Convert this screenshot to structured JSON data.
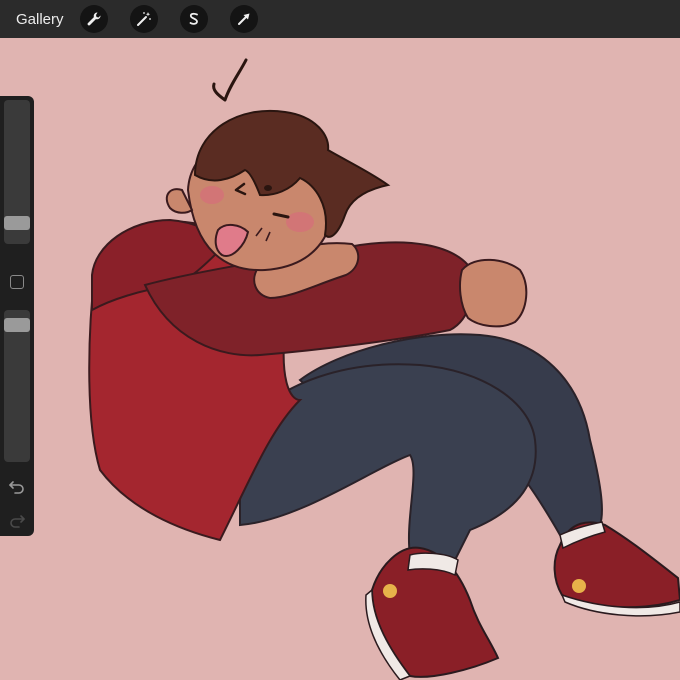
{
  "toolbar": {
    "gallery_label": "Gallery",
    "tools": [
      {
        "icon": "wrench-icon",
        "name": "actions"
      },
      {
        "icon": "magic-wand-icon",
        "name": "adjustments"
      },
      {
        "icon": "selection-s-icon",
        "name": "selection"
      },
      {
        "icon": "arrow-cursor-icon",
        "name": "transform"
      }
    ]
  },
  "sidebar": {
    "brush_size_level": 0.2,
    "opacity_level": 0.93,
    "undo_icon": "undo-icon",
    "redo_icon": "redo-icon"
  },
  "colors": {
    "canvas_background": "#e0b4b1",
    "toolbar_background": "#2b2b2b",
    "sidebar_background": "#1f1f1f",
    "hoodie_red": "#a4262f",
    "hoodie_dark_red": "#7f2229",
    "jeans_blue": "#373c4c",
    "hair_brown": "#5a2c22",
    "skin": "#c9876d",
    "shoe_red": "#8a1f27",
    "shoe_dot_yellow": "#e7b24a"
  }
}
